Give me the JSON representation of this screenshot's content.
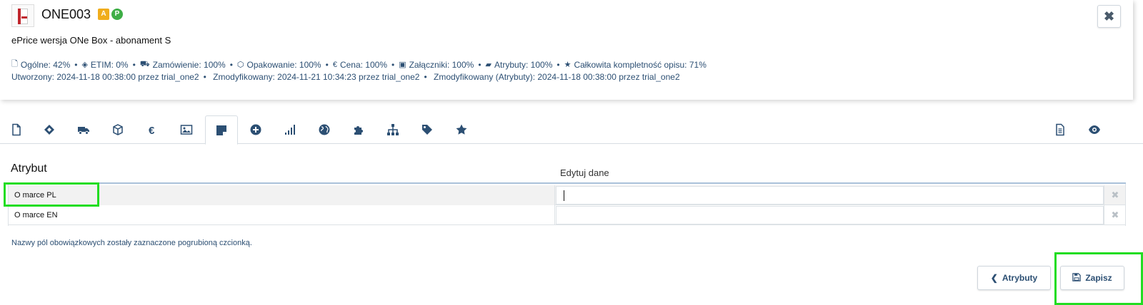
{
  "header": {
    "code": "ONE003",
    "badge_a": "A",
    "badge_p": "P",
    "product_name": "ePrice wersja ONe Box - abonament S",
    "stats": [
      {
        "icon": "file-icon",
        "text": "Ogólne: 42%"
      },
      {
        "icon": "etim-icon",
        "text": "ETIM: 0%"
      },
      {
        "icon": "truck-icon",
        "text": "Zamówienie: 100%"
      },
      {
        "icon": "box-icon",
        "text": "Opakowanie: 100%"
      },
      {
        "icon": "euro-icon",
        "text": "Cena: 100%"
      },
      {
        "icon": "image-icon",
        "text": "Załączniki: 100%"
      },
      {
        "icon": "note-icon",
        "text": "Atrybuty: 100%"
      },
      {
        "icon": "star-icon",
        "text": "Całkowita kompletność opisu: 71%"
      }
    ],
    "created": "Utworzony: 2024-11-18 00:38:00 przez trial_one2",
    "modified": "Zmodyfikowany: 2024-11-21 10:34:23 przez trial_one2",
    "modified_attrs": "Zmodyfikowany (Atrybuty): 2024-11-18 00:38:00 przez trial_one2"
  },
  "tabs": {
    "left": [
      "file-icon",
      "etim-icon",
      "truck-icon",
      "box-icon",
      "euro-icon",
      "image-icon",
      "note-icon",
      "plus-circle-icon",
      "signal-icon",
      "globe-icon",
      "puzzle-icon",
      "sitemap-icon",
      "tag-icon",
      "star-icon"
    ],
    "active": "note-icon",
    "right": [
      "document-icon",
      "eye-icon"
    ]
  },
  "table": {
    "col_attr": "Atrybut",
    "col_edit": "Edytuj dane",
    "rows": [
      {
        "name": "O marce PL",
        "value": ""
      },
      {
        "name": "O marce EN",
        "value": ""
      }
    ]
  },
  "note": "Nazwy pól obowiązkowych zostały zaznaczone pogrubioną czcionką.",
  "buttons": {
    "back": "Atrybuty",
    "save": "Zapisz"
  },
  "colors": {
    "primary": "#2c4f73",
    "highlight": "#22dd22",
    "badge_a": "#f0ad1c",
    "badge_p": "#3eae46"
  }
}
